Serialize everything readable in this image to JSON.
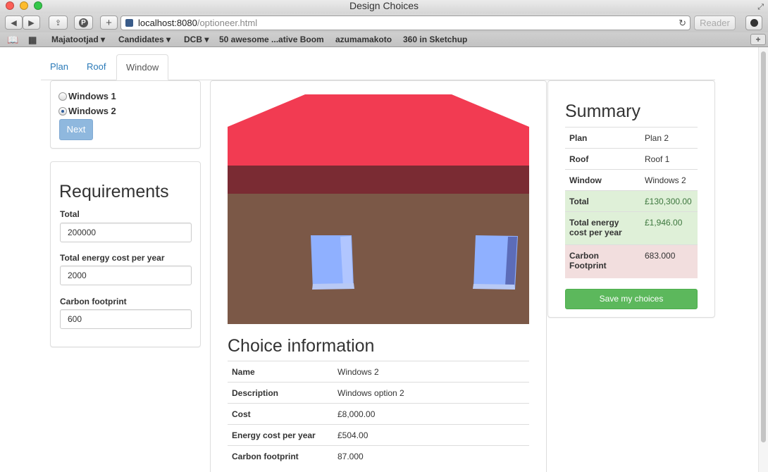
{
  "window": {
    "title": "Design Choices"
  },
  "browser": {
    "url_host": "localhost:8080",
    "url_path": "/optioneer.html",
    "reader_label": "Reader",
    "bookmarks": [
      {
        "label": "Majatootjad",
        "dropdown": true
      },
      {
        "label": "Candidates",
        "dropdown": true
      },
      {
        "label": "DCB",
        "dropdown": true
      },
      {
        "label": "50 awesome ...ative Boom",
        "dropdown": false
      },
      {
        "label": "azumamakoto",
        "dropdown": false
      },
      {
        "label": "360 in Sketchup",
        "dropdown": false
      }
    ]
  },
  "tabs": [
    {
      "label": "Plan",
      "active": false
    },
    {
      "label": "Roof",
      "active": false
    },
    {
      "label": "Window",
      "active": true
    }
  ],
  "options": {
    "items": [
      {
        "label": "Windows 1",
        "checked": false
      },
      {
        "label": "Windows 2",
        "checked": true
      }
    ],
    "next_label": "Next"
  },
  "requirements": {
    "title": "Requirements",
    "fields": [
      {
        "label": "Total",
        "value": "200000"
      },
      {
        "label": "Total energy cost per year",
        "value": "2000"
      },
      {
        "label": "Carbon footprint",
        "value": "600"
      }
    ]
  },
  "house": {
    "roof_color": "#f23b52",
    "eave_color": "#7a2b33",
    "wall_color": "#7b5847",
    "window_color": "#8fb0ff"
  },
  "choice": {
    "title": "Choice information",
    "rows": [
      {
        "key": "Name",
        "value": "Windows 2"
      },
      {
        "key": "Description",
        "value": "Windows option 2"
      },
      {
        "key": "Cost",
        "value": "£8,000.00"
      },
      {
        "key": "Energy cost per year",
        "value": "£504.00"
      },
      {
        "key": "Carbon footprint",
        "value": "87.000"
      }
    ]
  },
  "summary": {
    "title": "Summary",
    "rows": [
      {
        "key": "Plan",
        "value": "Plan 2",
        "status": "none"
      },
      {
        "key": "Roof",
        "value": "Roof 1",
        "status": "none"
      },
      {
        "key": "Window",
        "value": "Windows 2",
        "status": "none"
      },
      {
        "key": "Total",
        "value": "£130,300.00",
        "status": "ok"
      },
      {
        "key": "Total energy cost per year",
        "value": "£1,946.00",
        "status": "ok"
      },
      {
        "key": "Carbon Footprint",
        "value": "683.000",
        "status": "over"
      }
    ],
    "save_label": "Save my choices"
  },
  "colors": {
    "link": "#2a7ab8",
    "success_bg": "#dff0d8",
    "success_text": "#3c763d",
    "danger_bg": "#f2dede",
    "save_button": "#5cb85c",
    "next_button": "#8fb8de"
  }
}
